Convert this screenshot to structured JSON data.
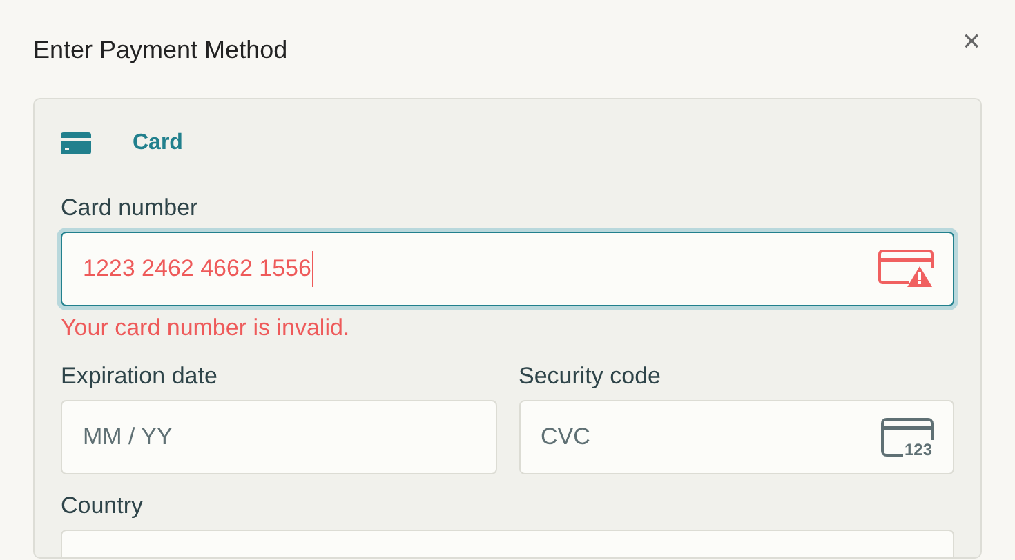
{
  "dialog": {
    "title": "Enter Payment Method",
    "close": "×"
  },
  "method": {
    "label": "Card",
    "selected": true
  },
  "card_number": {
    "label": "Card number",
    "value": "1223 2462 4662 1556",
    "focused": true,
    "invalid": true,
    "error": "Your card number is invalid."
  },
  "expiration": {
    "label": "Expiration date",
    "placeholder": "MM / YY"
  },
  "security_code": {
    "label": "Security code",
    "placeholder": "CVC",
    "icon_text": "123"
  },
  "country": {
    "label": "Country"
  }
}
